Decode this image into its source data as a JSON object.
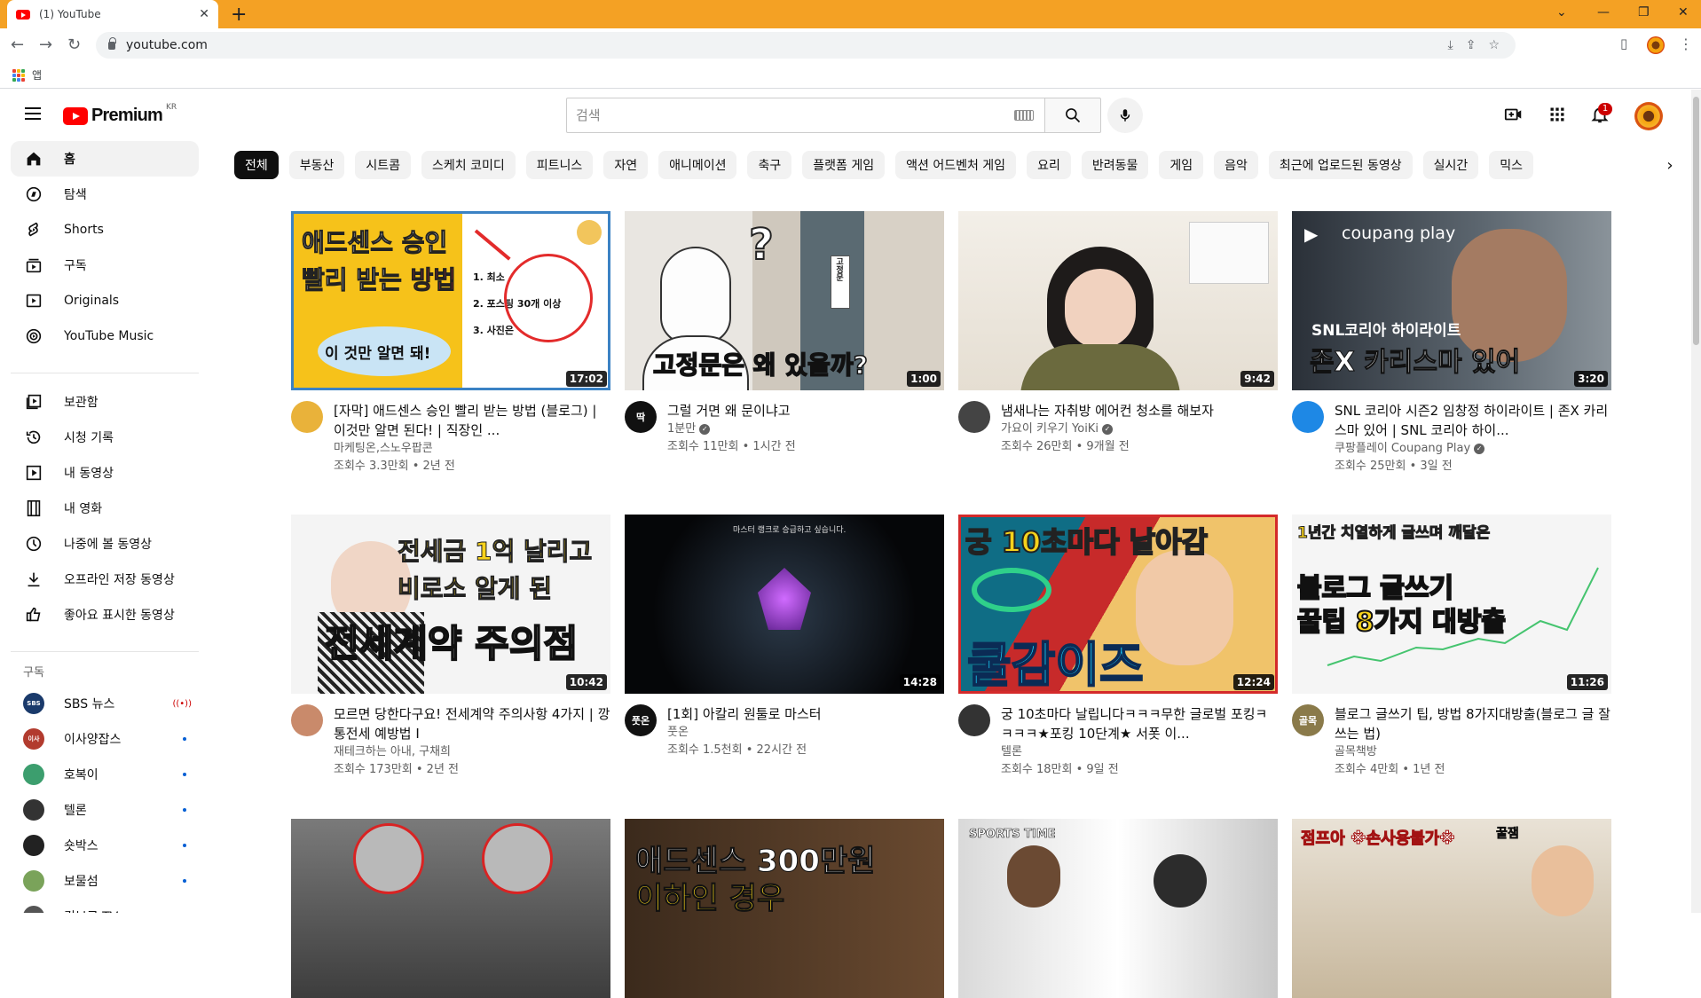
{
  "browser": {
    "tab_title": "(1) YouTube",
    "url": "youtube.com",
    "bookmarks_label": "앱"
  },
  "masthead": {
    "logo_word": "Premium",
    "logo_region": "KR",
    "search_placeholder": "검색",
    "notification_count": "1"
  },
  "sidebar": {
    "primary": [
      {
        "label": "홈",
        "icon": "home-icon"
      },
      {
        "label": "탐색",
        "icon": "compass-icon"
      },
      {
        "label": "Shorts",
        "icon": "shorts-icon"
      },
      {
        "label": "구독",
        "icon": "subscriptions-icon"
      },
      {
        "label": "Originals",
        "icon": "originals-icon"
      },
      {
        "label": "YouTube Music",
        "icon": "music-icon"
      }
    ],
    "library": [
      {
        "label": "보관함",
        "icon": "library-icon"
      },
      {
        "label": "시청 기록",
        "icon": "history-icon"
      },
      {
        "label": "내 동영상",
        "icon": "my-videos-icon"
      },
      {
        "label": "내 영화",
        "icon": "movies-icon"
      },
      {
        "label": "나중에 볼 동영상",
        "icon": "watch-later-icon"
      },
      {
        "label": "오프라인 저장 동영상",
        "icon": "download-icon"
      },
      {
        "label": "좋아요 표시한 동영상",
        "icon": "like-icon"
      }
    ],
    "subscriptions_heading": "구독",
    "subscriptions": [
      {
        "name": "SBS 뉴스",
        "avatar_text": "SBS",
        "color": "#1a3a6b",
        "status": "live"
      },
      {
        "name": "이사양잡스",
        "avatar_text": "이사",
        "color": "#b23b2e",
        "status": "dot"
      },
      {
        "name": "호복이",
        "avatar_text": "",
        "color": "#3c9e6e",
        "status": "dot"
      },
      {
        "name": "텔론",
        "avatar_text": "",
        "color": "#333333",
        "status": "dot"
      },
      {
        "name": "숏박스",
        "avatar_text": "",
        "color": "#222222",
        "status": "dot"
      },
      {
        "name": "보물섬",
        "avatar_text": "",
        "color": "#7aa35a",
        "status": "dot"
      },
      {
        "name": "김브로 TV",
        "avatar_text": "",
        "color": "#555555",
        "status": ""
      }
    ]
  },
  "chips": [
    "전체",
    "부동산",
    "시트콤",
    "스케치 코미디",
    "피트니스",
    "자연",
    "애니메이션",
    "축구",
    "플랫폼 게임",
    "액션 어드벤처 게임",
    "요리",
    "반려동물",
    "게임",
    "음악",
    "최근에 업로드된 동영상",
    "실시간",
    "믹스"
  ],
  "videos": [
    {
      "title": "[자막] 애드센스 승인 빨리 받는 방법 (블로그) | 이것만 알면 된다! | 직장인 ...",
      "channel": "마케팅온,스노우팝콘",
      "verified": false,
      "stats": "조회수 3.3만회 • 2년 전",
      "duration": "17:02",
      "avatar_color": "#e9b23a",
      "avatar_text": ""
    },
    {
      "title": "그럴 거면 왜 문이냐고",
      "channel": "1분만",
      "verified": true,
      "stats": "조회수 11만회 • 1시간 전",
      "duration": "1:00",
      "avatar_color": "#111111",
      "avatar_text": "딱"
    },
    {
      "title": "냄새나는 자취방 에어컨 청소를 해보자",
      "channel": "가요이 키우기 YoiKi",
      "verified": true,
      "stats": "조회수 26만회 • 9개월 전",
      "duration": "9:42",
      "avatar_color": "#444444",
      "avatar_text": ""
    },
    {
      "title": "SNL 코리아 시즌2 임창정 하이라이트 | 존X 카리스마 있어 | SNL 코리아 하이...",
      "channel": "쿠팡플레이 Coupang Play",
      "verified": true,
      "stats": "조회수 25만회 • 3일 전",
      "duration": "3:20",
      "avatar_color": "#1e88e5",
      "avatar_text": ""
    },
    {
      "title": "모르면 당한다구요! 전세계약 주의사항 4가지 | 깡통전세 예방법 I",
      "channel": "재테크하는 아내, 구채희",
      "verified": false,
      "stats": "조회수 173만회 • 2년 전",
      "duration": "10:42",
      "avatar_color": "#c98a6b",
      "avatar_text": ""
    },
    {
      "title": "[1회] 아칼리 원툴로 마스터",
      "channel": "풋온",
      "verified": false,
      "stats": "조회수 1.5천회 • 22시간 전",
      "duration": "14:28",
      "avatar_color": "#111111",
      "avatar_text": "풋온"
    },
    {
      "title": "궁 10초마다 날립니다ㅋㅋㅋ무한 글로벌 포킹ㅋㅋㅋㅋ★포킹 10단계★ 서폿 이...",
      "channel": "텔론",
      "verified": false,
      "stats": "조회수 18만회 • 9일 전",
      "duration": "12:24",
      "avatar_color": "#333333",
      "avatar_text": ""
    },
    {
      "title": "블로그 글쓰기 팁, 방법 8가지대방출(블로그 글 잘쓰는 법)",
      "channel": "골목책방",
      "verified": false,
      "stats": "조회수 4만회 • 1년 전",
      "duration": "11:26",
      "avatar_color": "#8a7a4a",
      "avatar_text": "골목"
    },
    {
      "title": "",
      "channel": "",
      "verified": false,
      "stats": "",
      "duration": "",
      "avatar_color": "#555",
      "avatar_text": ""
    },
    {
      "title": "",
      "channel": "",
      "verified": false,
      "stats": "",
      "duration": "",
      "avatar_color": "#555",
      "avatar_text": ""
    },
    {
      "title": "",
      "channel": "",
      "verified": false,
      "stats": "",
      "duration": "",
      "avatar_color": "#555",
      "avatar_text": ""
    },
    {
      "title": "",
      "channel": "",
      "verified": false,
      "stats": "",
      "duration": "",
      "avatar_color": "#555",
      "avatar_text": ""
    }
  ],
  "thumb_text": {
    "t1_title1": "애드센스 승인",
    "t1_title2a": "빨리 받는 ",
    "t1_title2b": "방법",
    "t1_bubble": "이 것만 알면 돼!",
    "t1_list": [
      "1.  최소",
      "2.  포스팅 30개 이상",
      "3.  사진은"
    ],
    "t2_big": "고정문은 왜 있을까?",
    "t2_sign": "고정문",
    "t4_brand": "coupang play",
    "t4_sub": "SNL코리아 하이라이트",
    "t4_big": "존X 카리스마 있어",
    "t5_line1": "전세금 1억 날리고",
    "t5_line2": "비로소 알게 된",
    "t5_big": "전세계약 주의점",
    "t6_top": "마스터 랭크로 승급하고 싶습니다.",
    "t7_top": "궁 10초마다 날아감",
    "t7_big": "쿨감이즈",
    "t8_line1": "1년간 치열하게 글쓰며 깨달은",
    "t8_line2": "블로그 글쓰기",
    "t8_line3a": "꿀팁 ",
    "t8_line3b": "8가지",
    "t8_line3c": " 대방출",
    "t10_line1": "애드센스 300만원",
    "t10_line2": "이하인 경우",
    "t11_brand": "SPORTS TIME",
    "t12_top": "점프아 ※손사용불가※",
    "t12_badge": "꿀잼"
  }
}
